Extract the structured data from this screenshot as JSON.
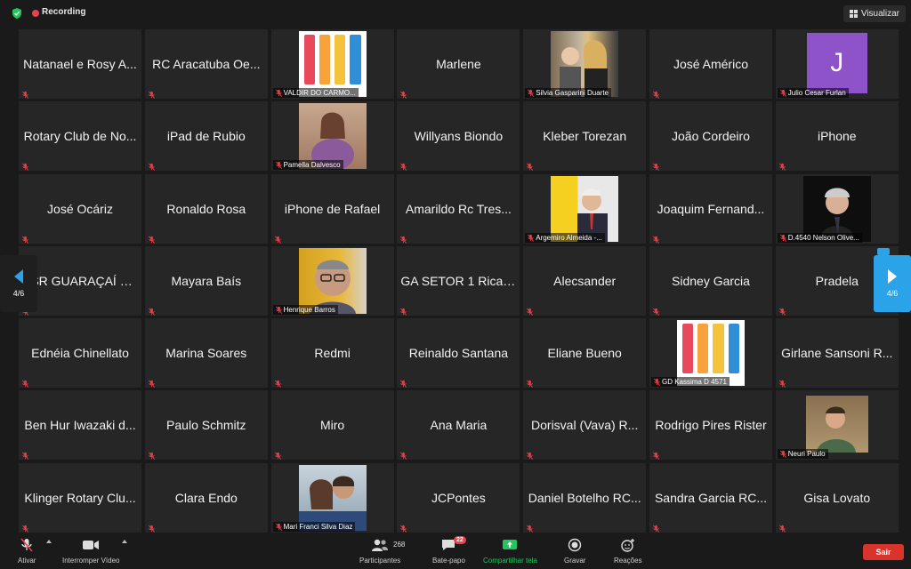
{
  "topbar": {
    "recording_label": "Recording",
    "view_label": "Visualizar",
    "icons": {
      "shield": "shield-check-icon",
      "view": "grid-view-icon"
    }
  },
  "participants": [
    {
      "name": "Natanael e Rosy A...",
      "video": false
    },
    {
      "name": "RC Aracatuba Oe...",
      "video": false
    },
    {
      "name": "VALDIR DO CARMO...",
      "video": "doors"
    },
    {
      "name": "Marlene",
      "video": false
    },
    {
      "name": "Silvia Gasparini Duarte",
      "video": "photo-couple"
    },
    {
      "name": "José Américo",
      "video": false
    },
    {
      "name": "Julio Cesar Furlan",
      "video": "avatar",
      "avatar_letter": "J"
    },
    {
      "name": "Rotary Club de No...",
      "video": false
    },
    {
      "name": "iPad de Rubio",
      "video": false
    },
    {
      "name": "Pamella Dalvesco",
      "video": "photo-woman"
    },
    {
      "name": "Willyans Biondo",
      "video": false
    },
    {
      "name": "Kleber Torezan",
      "video": false
    },
    {
      "name": "João Cordeiro",
      "video": false
    },
    {
      "name": "iPhone",
      "video": false
    },
    {
      "name": "José Ocáriz",
      "video": false
    },
    {
      "name": "Ronaldo Rosa",
      "video": false
    },
    {
      "name": "iPhone de Rafael",
      "video": false
    },
    {
      "name": "Amarildo Rc Tres...",
      "video": false
    },
    {
      "name": "Argemiro Almeida -...",
      "video": "photo-yellow"
    },
    {
      "name": "Joaquim Fernand...",
      "video": false
    },
    {
      "name": "D.4540 Nelson Olive...",
      "video": "photo-man-dark"
    },
    {
      "name": "ASR GUARAÇAÍ S...",
      "video": false
    },
    {
      "name": "Mayara Baís",
      "video": false
    },
    {
      "name": "Henrique Barros",
      "video": "photo-man-glasses"
    },
    {
      "name": "GA SETOR 1 Ricar...",
      "video": false
    },
    {
      "name": "Alecsander",
      "video": false
    },
    {
      "name": "Sidney Garcia",
      "video": false
    },
    {
      "name": "Pradela",
      "video": false
    },
    {
      "name": "Ednéia Chinellato",
      "video": false
    },
    {
      "name": "Marina Soares",
      "video": false
    },
    {
      "name": "Redmi",
      "video": false
    },
    {
      "name": "Reinaldo Santana",
      "video": false
    },
    {
      "name": "Eliane Bueno",
      "video": false
    },
    {
      "name": "GD Kassima D 4571",
      "video": "doors"
    },
    {
      "name": "Girlane Sansoni R...",
      "video": false
    },
    {
      "name": "Ben Hur Iwazaki d...",
      "video": false
    },
    {
      "name": "Paulo Schmitz",
      "video": false
    },
    {
      "name": "Miro",
      "video": false
    },
    {
      "name": "Ana Maria",
      "video": false
    },
    {
      "name": "Dorisval (Vava) R...",
      "video": false
    },
    {
      "name": "Rodrigo Pires Rister",
      "video": false
    },
    {
      "name": "Neuri Paulo",
      "video": "photo-man-smile"
    },
    {
      "name": "Klinger Rotary Clu...",
      "video": false
    },
    {
      "name": "Clara Endo",
      "video": false
    },
    {
      "name": "Mari Franci Silva Diaz",
      "video": "photo-couple2"
    },
    {
      "name": "JCPontes",
      "video": false
    },
    {
      "name": "Daniel Botelho RC...",
      "video": false
    },
    {
      "name": "Sandra Garcia RC...",
      "video": false
    },
    {
      "name": "Gisa Lovato",
      "video": false
    }
  ],
  "pager": {
    "prev_label": "4/6",
    "next_label": "4/6"
  },
  "bottombar": {
    "mic_label": "Ativar",
    "video_label": "Interromper Vídeo",
    "participants_label": "Participantes",
    "participants_count": "268",
    "chat_label": "Bate-papo",
    "chat_badge": "22",
    "share_label": "Compartilhar tela",
    "record_label": "Gravar",
    "reactions_label": "Reações",
    "leave_label": "Sair"
  },
  "colors": {
    "accent": "#2ba3e8",
    "recording": "#e8414e",
    "share": "#22c55e",
    "leave": "#d9342b",
    "tile": "#262626"
  },
  "door_colors": [
    "#e9495c",
    "#f7a23a",
    "#f4c23c",
    "#2f8fd6"
  ]
}
